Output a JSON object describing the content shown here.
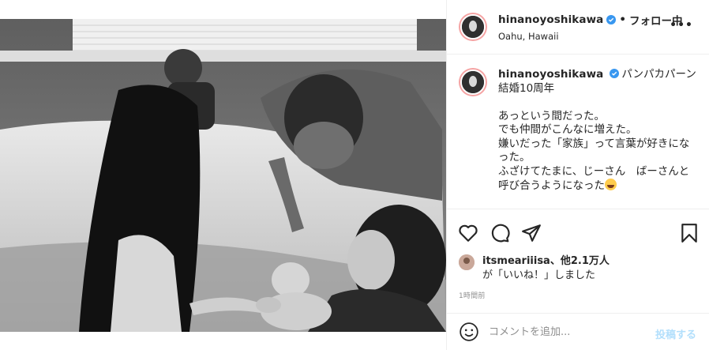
{
  "post": {
    "image_description": "photo-post",
    "author": {
      "username": "hinanoyoshikawa",
      "verified": true,
      "follow_status": "フォロー中",
      "location": "Oahu, Hawaii"
    },
    "caption": {
      "username": "hinanoyoshikawa",
      "text": "パンパカパーン\n結婚10周年\n\nあっという間だった。\nでも仲間がこんなに増えた。\n嫌いだった「家族」って言葉が好きになった。\nふざけてたまに、じーさん　ばーさんと呼び合うようになった"
    },
    "likes": {
      "first_user": "itsmeariiisa",
      "others": "、他2.1万人",
      "suffix": "が「いいね！」しました"
    },
    "time": "1時間前"
  },
  "comment": {
    "placeholder": "コメントを追加...",
    "post_label": "投稿する"
  },
  "icons": {
    "verified": "verified-badge-icon",
    "more": "more-options-icon",
    "like": "heart-icon",
    "comment": "comment-bubble-icon",
    "share": "paper-plane-icon",
    "save": "bookmark-icon",
    "emoji": "smiley-icon"
  },
  "colors": {
    "verified_blue": "#3897f0",
    "post_button_disabled": "#b2dffc",
    "avatar_ring": "#f5a3a3"
  }
}
